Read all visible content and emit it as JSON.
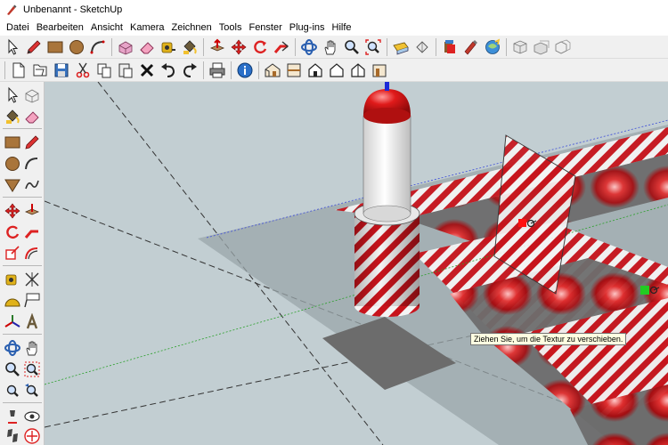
{
  "window": {
    "title": "Unbenannt - SketchUp"
  },
  "menu": [
    "Datei",
    "Bearbeiten",
    "Ansicht",
    "Kamera",
    "Zeichnen",
    "Tools",
    "Fenster",
    "Plug-ins",
    "Hilfe"
  ],
  "viewport": {
    "tooltip": "Ziehen Sie, um die Textur zu verschieben."
  },
  "colors": {
    "viewport_bg": "#c2ced2",
    "stripe_red": "#c8141c",
    "stripe_white": "#f4f4f4",
    "pin_red": "#ff1010",
    "pin_green": "#22cc22",
    "axis_green": "#2aa02a",
    "axis_blue": "#3a4ad8"
  },
  "icons": {
    "toolbar1": [
      "select-icon",
      "pencil-icon",
      "rectangle-icon",
      "circle-icon",
      "arc-icon",
      "make-component-icon",
      "eraser-icon",
      "tape-measure-icon",
      "paint-bucket-icon",
      "push-pull-icon",
      "move-icon",
      "rotate-icon",
      "follow-me-icon",
      "orbit-icon",
      "pan-icon",
      "zoom-icon",
      "zoom-extents-icon",
      "3d-warehouse-icon",
      "extension-warehouse-icon",
      "layout-icon",
      "sketchup-logo-icon",
      "previous-view-icon",
      "next-view-icon",
      "scene-icon"
    ],
    "toolbar2": [
      "new-file-icon",
      "open-file-icon",
      "save-icon",
      "cut-icon",
      "copy-icon",
      "paste-icon",
      "delete-icon",
      "undo-icon",
      "redo-icon",
      "print-icon",
      "model-info-icon",
      "iso-view-icon",
      "top-view-icon",
      "front-view-icon",
      "right-view-icon",
      "back-view-icon",
      "left-view-icon"
    ]
  }
}
